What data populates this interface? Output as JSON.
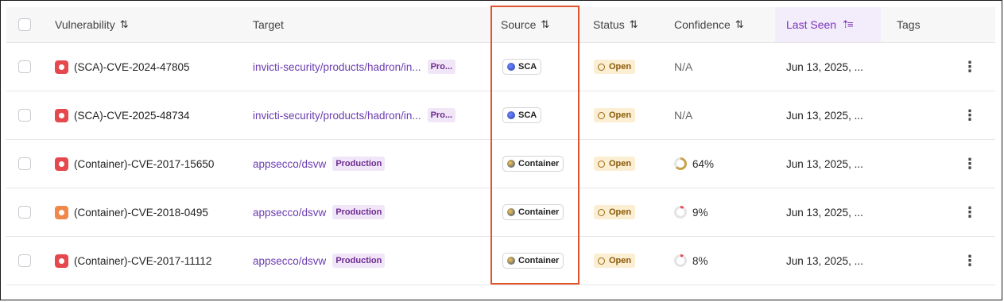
{
  "columns": {
    "vulnerability": "Vulnerability",
    "target": "Target",
    "source": "Source",
    "status": "Status",
    "confidence": "Confidence",
    "last_seen": "Last Seen",
    "tags": "Tags"
  },
  "sort_icon": "⇅",
  "sort_active_icon": "⇡≡",
  "rows": [
    {
      "severity_color": "#e5484d",
      "name": "(SCA)-CVE-2024-47805",
      "target": "invicti-security/products/hadron/in...",
      "env": "Pro...",
      "source": "SCA",
      "source_icon": "sca-icon",
      "status": "Open",
      "confidence": "N/A",
      "confidence_value": null,
      "date": "Jun 13, 2025, ..."
    },
    {
      "severity_color": "#e5484d",
      "name": "(SCA)-CVE-2025-48734",
      "target": "invicti-security/products/hadron/in...",
      "env": "Pro...",
      "source": "SCA",
      "source_icon": "sca-icon",
      "status": "Open",
      "confidence": "N/A",
      "confidence_value": null,
      "date": "Jun 13, 2025, ..."
    },
    {
      "severity_color": "#e5484d",
      "name": "(Container)-CVE-2017-15650",
      "target": "appsecco/dsvw",
      "env": "Production",
      "source": "Container",
      "source_icon": "container-icon",
      "status": "Open",
      "confidence": "64%",
      "confidence_value": 64,
      "confidence_color": "#c9a34a",
      "date": "Jun 13, 2025, ..."
    },
    {
      "severity_color": "#f0884a",
      "name": "(Container)-CVE-2018-0495",
      "target": "appsecco/dsvw",
      "env": "Production",
      "source": "Container",
      "source_icon": "container-icon",
      "status": "Open",
      "confidence": "9%",
      "confidence_value": 9,
      "confidence_color": "#e5484d",
      "date": "Jun 13, 2025, ..."
    },
    {
      "severity_color": "#e5484d",
      "name": "(Container)-CVE-2017-11112",
      "target": "appsecco/dsvw",
      "env": "Production",
      "source": "Container",
      "source_icon": "container-icon",
      "status": "Open",
      "confidence": "8%",
      "confidence_value": 8,
      "confidence_color": "#e5484d",
      "date": "Jun 13, 2025, ..."
    }
  ],
  "kebab": "⋮",
  "highlight_color": "#e0532b"
}
